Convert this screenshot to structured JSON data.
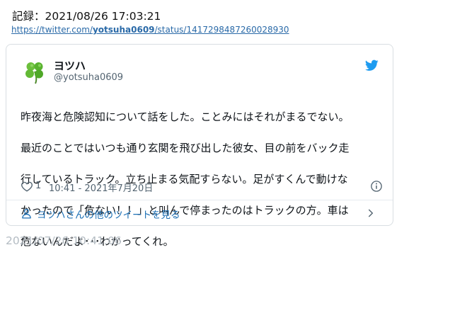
{
  "record": {
    "label": "記録：",
    "datetime": "2021/08/26 17:03:21"
  },
  "source_url": {
    "prefix": "https://twitter.com/",
    "user": "yotsuha0609",
    "suffix": "/status/1417298487260028930"
  },
  "tweet": {
    "author_name": "ヨツハ",
    "author_handle": "@yotsuha0609",
    "text_lines": [
      "昨夜海と危険認知について話をした。ことみにはそれがまるでない。",
      "最近のことではいつも通り玄関を飛び出した彼女、目の前をバック走",
      "行しているトラック。立ち止まる気配すらない。足がすくんで動けな",
      "かったので「危ない！！」と叫んで停まったのはトラックの方。車は",
      "危ないんだよ･･･わかってくれ。"
    ],
    "likes": "1",
    "timestamp": "10:41 - 2021年7月20日",
    "more_tweets_label": "ヨツハさんの他のツイートを見る"
  },
  "archived_at": "2021/07/20 10:41:06",
  "icons": {
    "avatar": "four-leaf-clover-avatar",
    "brand": "twitter-bird-icon",
    "like": "heart-icon",
    "info": "info-icon",
    "person": "person-icon",
    "chevron": "chevron-right-icon"
  },
  "colors": {
    "link": "#2a6aa8",
    "twitter_blue": "#1d9bf0",
    "muted": "#536471",
    "border": "#d9dee2",
    "archived_text": "#b4bcc3"
  }
}
